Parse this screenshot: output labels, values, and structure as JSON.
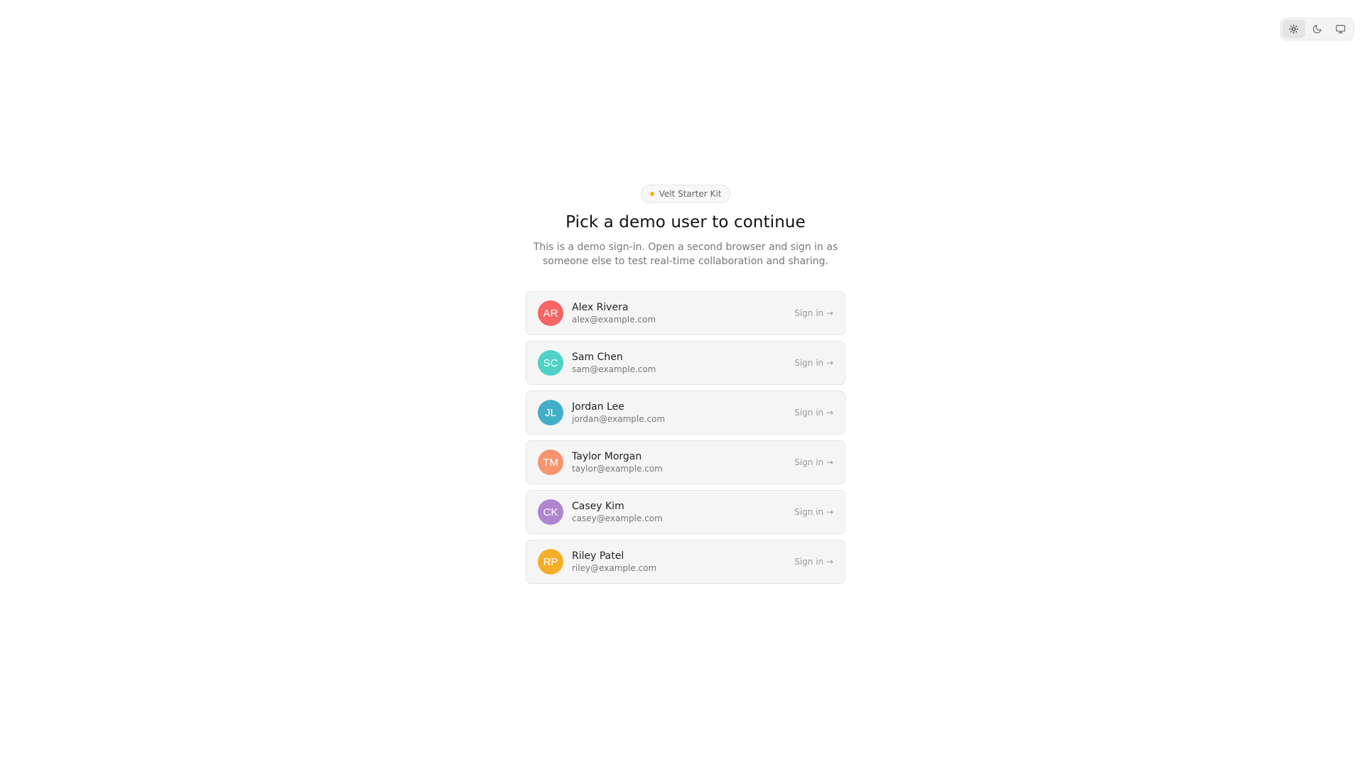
{
  "theme_switcher": {
    "options": [
      {
        "name": "light",
        "icon": "sun-icon",
        "active": true
      },
      {
        "name": "dark",
        "icon": "moon-icon",
        "active": false
      },
      {
        "name": "system",
        "icon": "monitor-icon",
        "active": false
      }
    ]
  },
  "badge": {
    "label": "Velt Starter Kit",
    "dot_color": "#f5b21b"
  },
  "title": "Pick a demo user to continue",
  "subtitle": "This is a demo sign-in. Open a second browser and sign in as someone else to test real-time collaboration and sharing.",
  "users": [
    {
      "initials": "AR",
      "name": "Alex Rivera",
      "email": "alex@example.com",
      "color": "#f56565",
      "action": "Sign in →"
    },
    {
      "initials": "SC",
      "name": "Sam Chen",
      "email": "sam@example.com",
      "color": "#4fd1c5",
      "action": "Sign in →"
    },
    {
      "initials": "JL",
      "name": "Jordan Lee",
      "email": "jordan@example.com",
      "color": "#42afc9",
      "action": "Sign in →"
    },
    {
      "initials": "TM",
      "name": "Taylor Morgan",
      "email": "taylor@example.com",
      "color": "#f6946d",
      "action": "Sign in →"
    },
    {
      "initials": "CK",
      "name": "Casey Kim",
      "email": "casey@example.com",
      "color": "#b085cf",
      "action": "Sign in →"
    },
    {
      "initials": "RP",
      "name": "Riley Patel",
      "email": "riley@example.com",
      "color": "#f5ae28",
      "action": "Sign in →"
    }
  ]
}
